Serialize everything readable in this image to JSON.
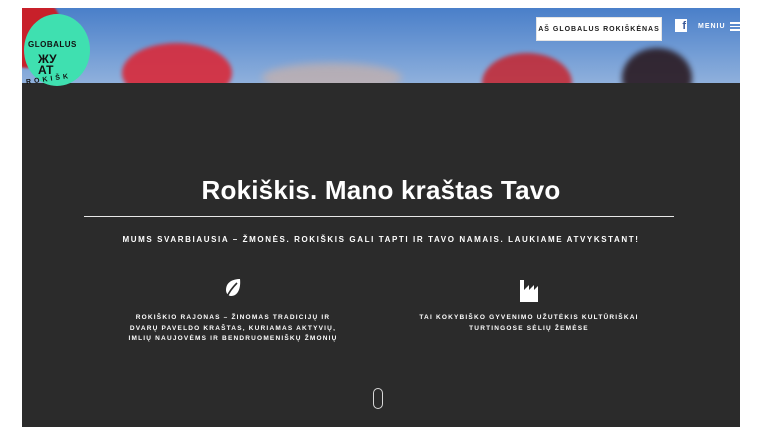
{
  "logo": {
    "text": "GLOBALUS",
    "glyph": "ЖУ\nАТ",
    "ring_text": "ROKIŠK"
  },
  "header": {
    "global_button_label": "AŠ GLOBALUS ROKIŠKĖNAS",
    "facebook_icon": "facebook-icon",
    "menu_label": "MENIU"
  },
  "main": {
    "title": "Rokiškis. Mano kraštas Tavo",
    "subtitle": "MUMS SVARBIAUSIA – ŽMONĖS. ROKIŠKIS GALI TAPTI IR TAVO NAMAIS. LAUKIAME ATVYKSTANT!",
    "features": [
      {
        "icon": "leaf-icon",
        "lines": [
          "ROKIŠKIO RAJONAS – ŽINOMAS TRADICIJŲ IR",
          "DVARŲ PAVELDO KRAŠTAS, KURIAMAS AKTYVIŲ,",
          "IMLIŲ NAUJOVĖMS IR BENDRUOMENIŠKŲ ŽMONIŲ"
        ]
      },
      {
        "icon": "factory-icon",
        "lines": [
          "TAI KOKYBIŠKO GYVENIMO UŽUTĖKIS KULTŪRIŠKAI",
          "TURTINGOSE SĖLIŲ ŽEMĖSE"
        ]
      }
    ]
  },
  "colors": {
    "background": "#2b2b2b",
    "logo_accent": "#3fe0b0",
    "sky": "#6f9ad4",
    "text": "#ffffff"
  }
}
